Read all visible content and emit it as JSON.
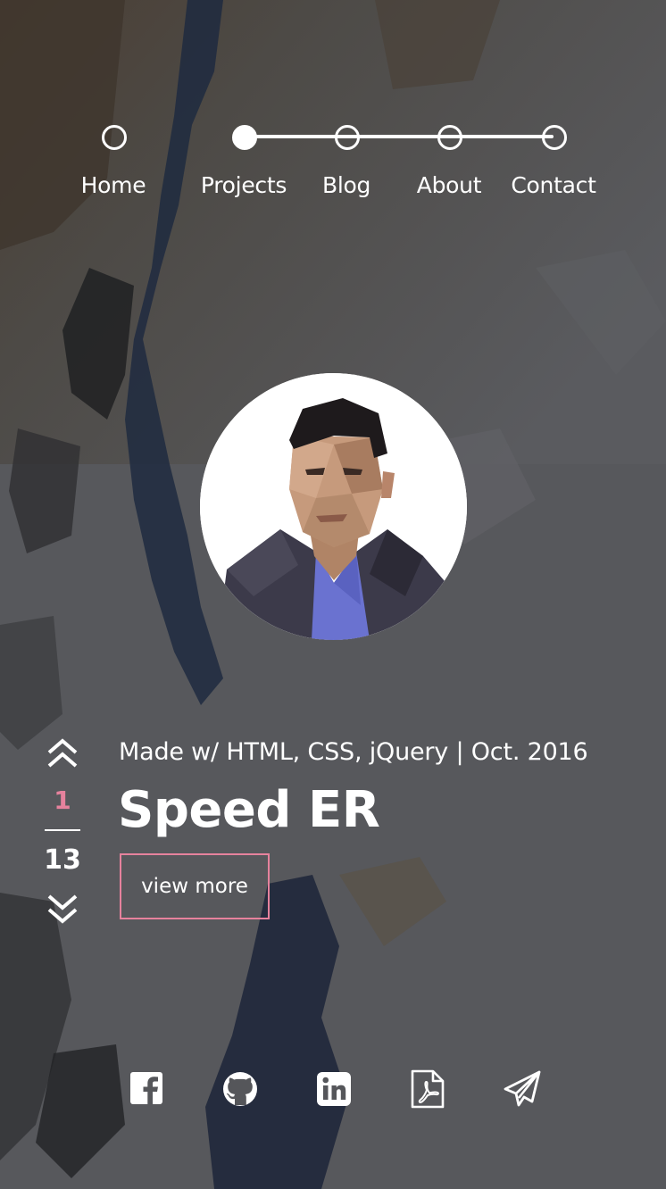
{
  "nav": {
    "items": [
      {
        "label": "Home",
        "active": false
      },
      {
        "label": "Projects",
        "active": true
      },
      {
        "label": "Blog",
        "active": false
      },
      {
        "label": "About",
        "active": false
      },
      {
        "label": "Contact",
        "active": false
      }
    ]
  },
  "profile": {
    "avatar_icon": "portrait-avatar"
  },
  "project": {
    "current": "1",
    "total": "13",
    "meta": "Made w/ HTML, CSS, jQuery | Oct. 2016",
    "title": "Speed ER",
    "view_more_label": "view more"
  },
  "social": [
    "facebook-icon",
    "github-icon",
    "linkedin-icon",
    "pdf-icon",
    "paper-plane-icon"
  ],
  "colors": {
    "accent": "#e6829d",
    "text": "#ffffff",
    "background": "#55565a"
  }
}
